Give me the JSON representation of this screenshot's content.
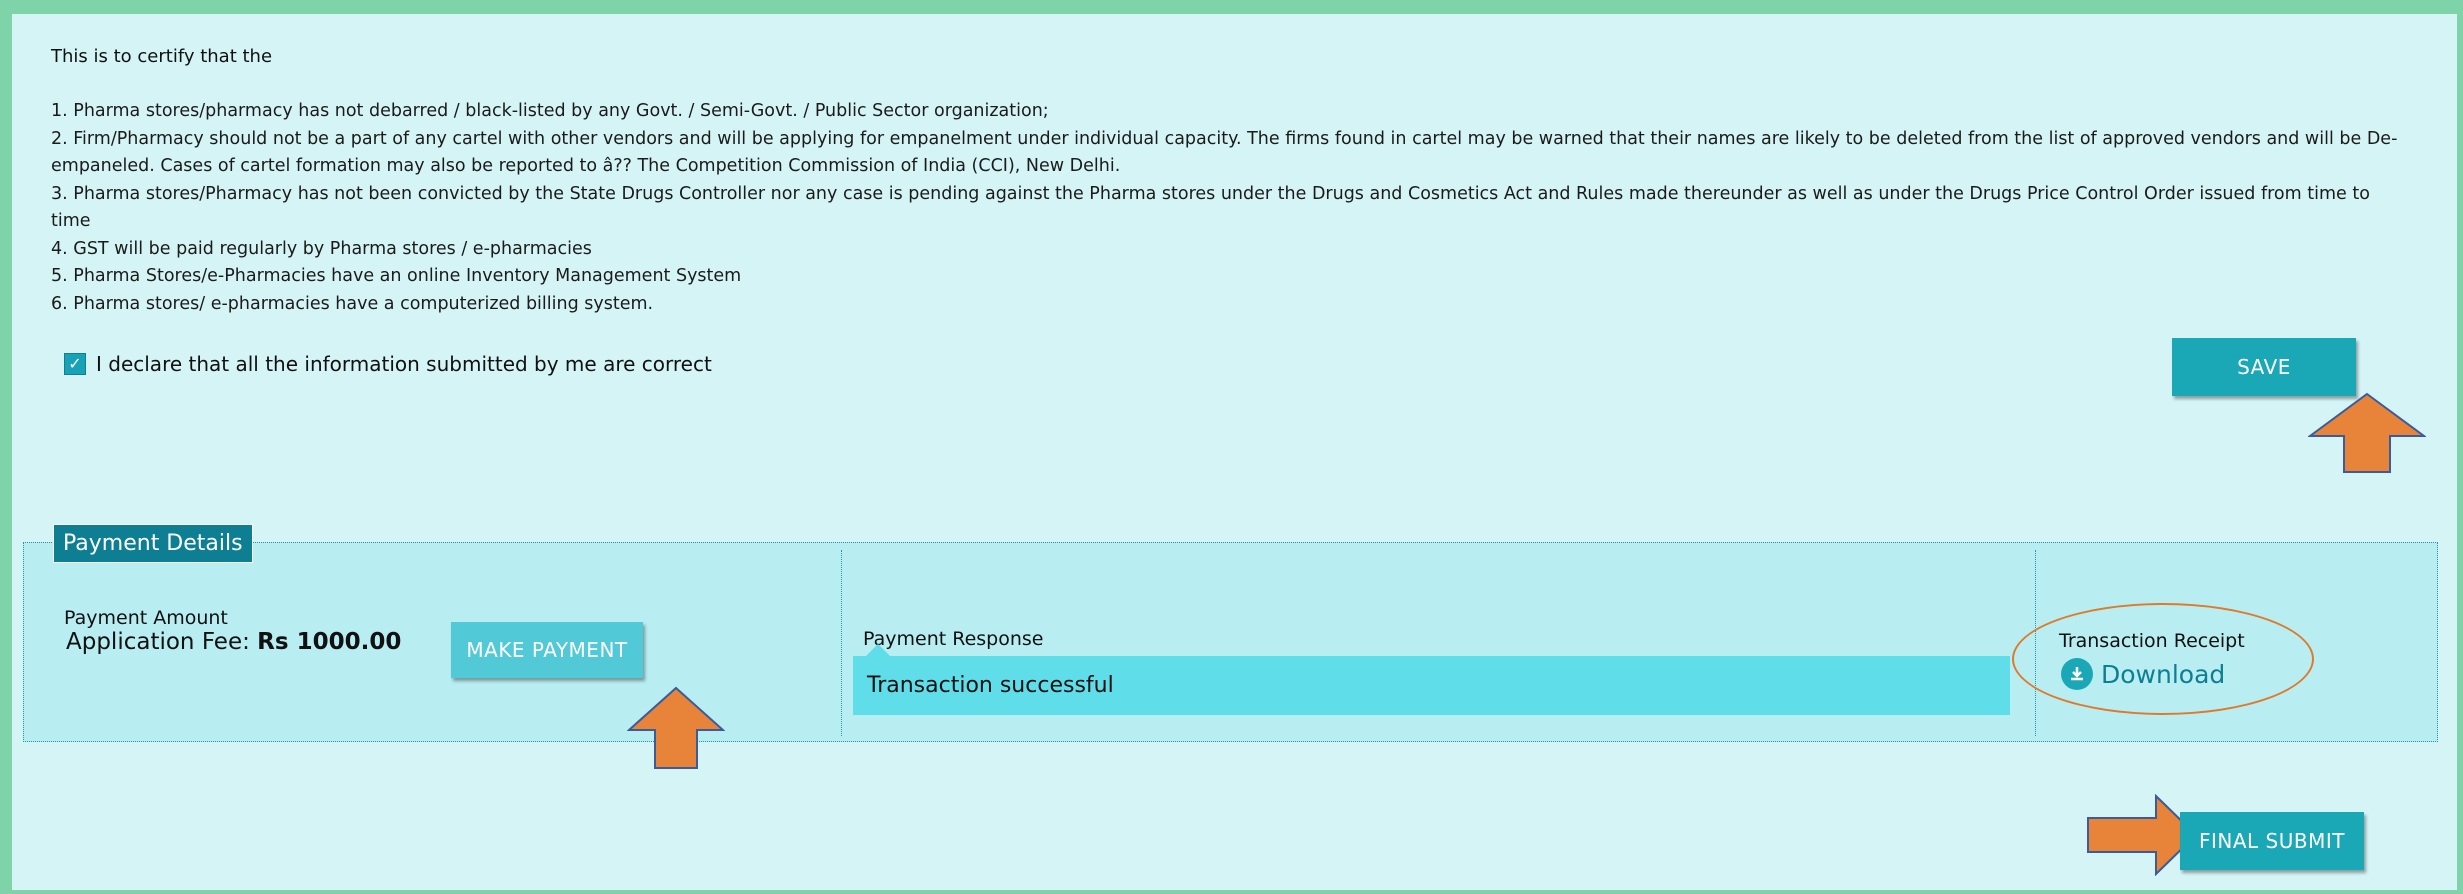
{
  "certification": {
    "heading": "This is to certify that the",
    "items": [
      "1. Pharma stores/pharmacy has not debarred / black-listed by any Govt. / Semi-Govt. / Public Sector organization;",
      "2. Firm/Pharmacy should not be a part of any cartel with other vendors and will be applying for empanelment under individual capacity. The firms found in cartel may be warned that their names are likely to be deleted from the list of approved vendors and will be De-empaneled. Cases of cartel formation may also be reported to â?? The Competition Commission of India (CCI), New Delhi.",
      "3. Pharma stores/Pharmacy has not been convicted by the State Drugs Controller nor any case is pending against the Pharma stores under the Drugs and Cosmetics Act and Rules made thereunder as well as under the Drugs Price Control Order issued from time to time",
      "4. GST will be paid regularly by Pharma stores / e-pharmacies",
      "5. Pharma Stores/e-Pharmacies have an online Inventory Management System",
      "6. Pharma stores/ e-pharmacies have a computerized billing system."
    ],
    "declaration": "I declare that all the information submitted by me are correct",
    "declaration_checked": true
  },
  "buttons": {
    "save": "SAVE",
    "make_payment": "MAKE PAYMENT",
    "final_submit": "FINAL SUBMIT"
  },
  "payment": {
    "legend": "Payment Details",
    "amount_label": "Payment Amount",
    "fee_label": "Application Fee: ",
    "fee_value": "Rs 1000.00",
    "response_label": "Payment Response",
    "response_value": "Transaction successful",
    "receipt_label": "Transaction Receipt",
    "download_label": "Download"
  },
  "colors": {
    "accent": "#1ba8b6",
    "frame": "#7fd3a9",
    "annotation": "#e8833a"
  },
  "icons": [
    "check-icon",
    "download-icon",
    "arrow-up-icon",
    "arrow-right-icon"
  ]
}
